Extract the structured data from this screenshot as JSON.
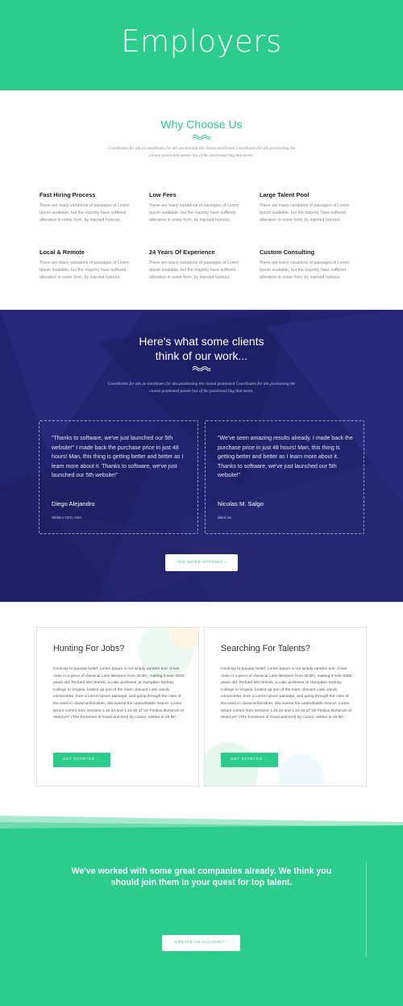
{
  "hero": {
    "title": "Employers"
  },
  "why": {
    "title": "Why Choose Us",
    "intro": "Coordinates for abs po oordinates for abs positioning the closest positioned Coordinates for abs positioning the closest positioned parent box of the positioned ling that meets.",
    "features": [
      {
        "title": "Fast Hiring Process",
        "text": "There are many variations of passages of Lorem Ipsum available, but the majority have suffered alteration in some form, by injected humour."
      },
      {
        "title": "Low Fees",
        "text": "There are many variations of passages of Lorem Ipsum available, but the majority have suffered alteration in some form, by injected humour."
      },
      {
        "title": "Large Talent Pool",
        "text": "There are many variations of passages of Lorem Ipsum available, but the majority have suffered alteration in some form, by injected humour."
      },
      {
        "title": "Local & Remote",
        "text": "There are many variations of passages of Lorem Ipsum available, but the majority have suffered alteration in some form, by injected humour."
      },
      {
        "title": "24 Years Of Experience",
        "text": "There are many variations of passages of Lorem Ipsum available, but the majority have suffered alteration in some form, by injected humour."
      },
      {
        "title": "Custom Consulting",
        "text": "There are many variations of passages of Lorem Ipsum available, but the majority have suffered alteration in some form, by injected humour."
      }
    ]
  },
  "testimonials": {
    "title_line1": "Here's what some clients",
    "title_line2": "think of our work...",
    "intro": "Coordinates for abs po oordinates for abs positioning the closest positioned Coordinates for abs positioning the closest positioned parent box of the positioned ling that meets.",
    "items": [
      {
        "quote": "\"Thanks to software, we've just launched our 5th website!\" I made back the purchase price in just 48 hours! Man, this thing is getting better and better as I learn more about it. Thanks to software, we've just launched our 5th website!\"",
        "name": "Diego Alejandro",
        "role": "Whitero CEO, USA"
      },
      {
        "quote": "\"We've seen amazing results already. I made back the purchase price in just 48 hours! Man, this thing is getting better and better as I learn more about it. Thanks to software, we've just launched our 5th website!\"",
        "name": "Nicolas M. Salgo",
        "role": "Black inc"
      }
    ],
    "more_button": "SEE MORE STORIES  ›"
  },
  "cards": [
    {
      "title": "Hunting For Jobs?",
      "text": "Contrary to popular belief, Lorem Ipsum is not simply random text. It has roots in a piece of classical Latin literature from 45 BC, making it over 2000 years old. Richard McClintock, a Latin professor at Hampden-Sydney College in Virginia, looked up one of the more obscure Latin words, consectetur, from a Lorem Ipsum passage, and going through the cites of the word in classical literature, discovered the undoubtable source. Lorem Ipsum comes from sections 1.10.32 and 1.10.33 of \"de Finibus Bonorum et Malorum\" (The Extremes of Good and Evil) by Cicero, written in 45 BC.",
      "button": "GET STARTED  →"
    },
    {
      "title": "Searching For Talents?",
      "text": "Contrary to popular belief, Lorem Ipsum is not simply random text. It has roots in a piece of classical Latin literature from 45 BC, making it over 2000 years old. Richard McClintock, a Latin professor at Hampden-Sydney College in Virginia, looked up one of the more obscure Latin words, consectetur, from a Lorem Ipsum passage, and going through the cites of the word in classical literature, discovered the undoubtable source. Lorem Ipsum comes from sections 1.10.32 and 1.10.33 of \"de Finibus Bonorum et Malorum\" (The Extremes of Good and Evil) by Cicero, written in 45 BC.",
      "button": "GET STARTED  →"
    }
  ],
  "cta": {
    "text": "We've worked with some great companies already. We think you should join them in your quest for top talent.",
    "button": "CREATE AN ACCOUNT  ›"
  },
  "colors": {
    "brand_green": "#2bcc8e",
    "navy": "#22236e"
  }
}
